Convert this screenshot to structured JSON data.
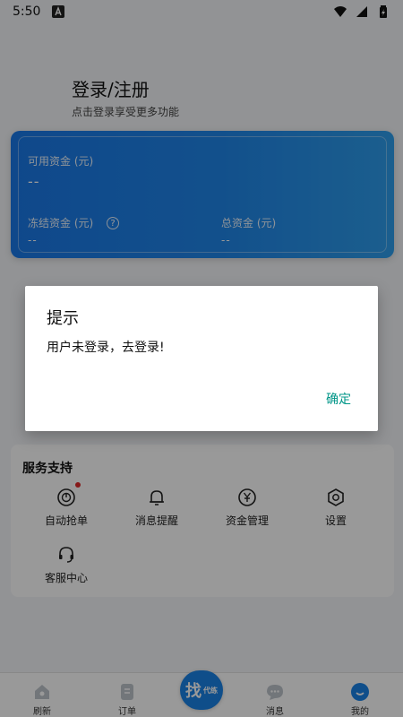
{
  "status_bar": {
    "time": "5:50"
  },
  "login": {
    "title": "登录/注册",
    "subtitle": "点击登录享受更多功能"
  },
  "assets": {
    "available_label": "可用资金 (元)",
    "available_value": "--",
    "frozen_label": "冻结资金 (元)",
    "frozen_value": "--",
    "total_label": "总资金 (元)",
    "total_value": "--"
  },
  "services": {
    "title": "服务支持",
    "items": [
      {
        "label": "自动抢单",
        "icon": "auto-grab-icon",
        "badge": true
      },
      {
        "label": "消息提醒",
        "icon": "bell-icon"
      },
      {
        "label": "资金管理",
        "icon": "yuan-icon"
      },
      {
        "label": "设置",
        "icon": "gear-icon"
      },
      {
        "label": "客服中心",
        "icon": "headset-icon"
      }
    ]
  },
  "bottom_nav": {
    "items": [
      {
        "label": "刷新",
        "icon": "home-icon"
      },
      {
        "label": "订单",
        "icon": "order-icon"
      },
      {
        "label": "消息",
        "icon": "chat-icon"
      },
      {
        "label": "我的",
        "icon": "profile-icon"
      }
    ],
    "center": {
      "main": "找",
      "small": "代练"
    }
  },
  "dialog": {
    "title": "提示",
    "message": "用户未登录，去登录!",
    "ok_label": "确定"
  },
  "colors": {
    "accent": "#1a82e6",
    "dialog_button": "#009688",
    "badge": "#e02a2a"
  }
}
